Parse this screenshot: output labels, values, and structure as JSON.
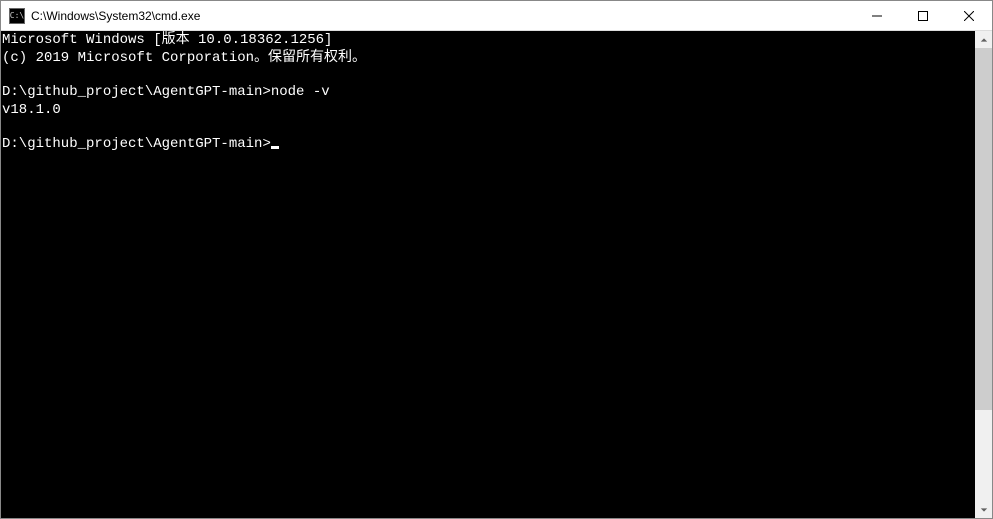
{
  "titlebar": {
    "icon_label": "C:\\",
    "title": "C:\\Windows\\System32\\cmd.exe"
  },
  "console": {
    "line1": "Microsoft Windows [版本 10.0.18362.1256]",
    "line2": "(c) 2019 Microsoft Corporation。保留所有权利。",
    "blank1": "",
    "prompt1": "D:\\github_project\\AgentGPT-main>",
    "cmd1": "node -v",
    "out1": "v18.1.0",
    "blank2": "",
    "prompt2": "D:\\github_project\\AgentGPT-main>"
  }
}
